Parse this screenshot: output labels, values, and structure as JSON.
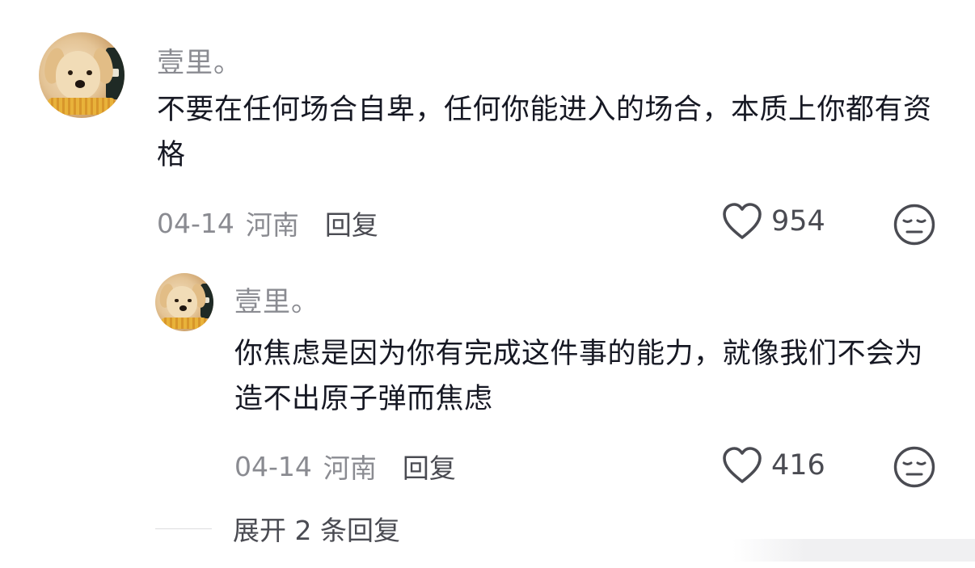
{
  "comments": [
    {
      "username": "壹里。",
      "text": "不要在任何场合自卑，任何你能进入的场合，本质上你都有资格",
      "date": "04-14",
      "location": "河南",
      "reply_label": "回复",
      "likes": "954"
    },
    {
      "username": "壹里。",
      "text": "你焦虑是因为你有完成这件事的能力，就像我们不会为造不出原子弹而焦虑",
      "date": "04-14",
      "location": "河南",
      "reply_label": "回复",
      "likes": "416"
    }
  ],
  "expand_label": "展开 2 条回复",
  "icons": {
    "like": "heart-outline-icon",
    "dislike": "unamused-face-icon",
    "avatar": "dog-avatar"
  },
  "colors": {
    "text_primary": "#161823",
    "text_secondary": "#8a8b91",
    "text_action": "#4a4b52"
  }
}
